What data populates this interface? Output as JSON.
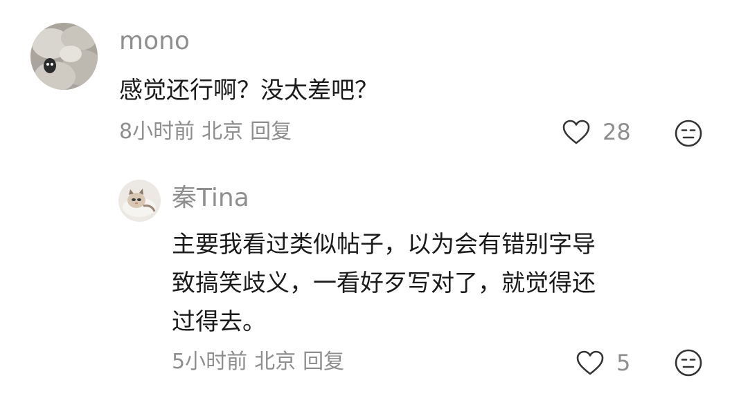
{
  "comments": [
    {
      "username": "mono",
      "text": "感觉还行啊？没太差吧？",
      "time": "8小时前",
      "location": "北京",
      "reply_label": "回复",
      "likes": "28"
    },
    {
      "username": "秦Tina",
      "text_lines": [
        "主要我看过类似帖子，以为会有错别字导",
        "致搞笑歧义，一看好歹写对了，就觉得还",
        "过得去。"
      ],
      "time": "5小时前",
      "location": "北京",
      "reply_label": "回复",
      "likes": "5"
    }
  ],
  "icons": {
    "like": "heart-outline-icon",
    "dislike": "neutral-face-icon"
  },
  "colors": {
    "meta_text": "#8e8e8e",
    "body_text": "#1a1a1a",
    "icon_stroke": "#333333"
  }
}
